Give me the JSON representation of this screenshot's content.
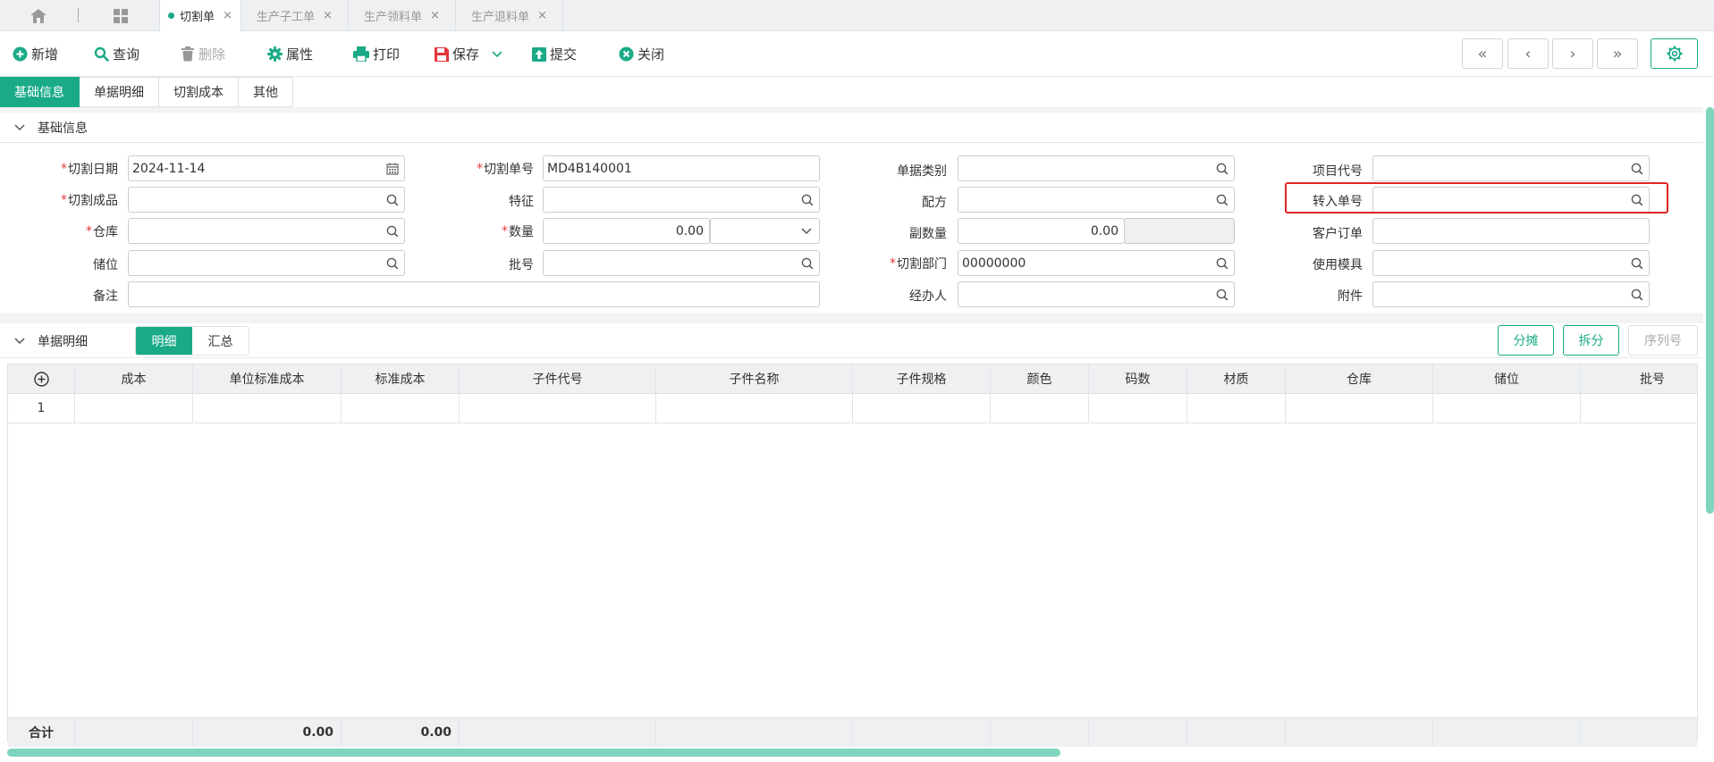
{
  "tabs": [
    {
      "label": "切割单",
      "active": true
    },
    {
      "label": "生产子工单",
      "active": false
    },
    {
      "label": "生产领料单",
      "active": false
    },
    {
      "label": "生产退料单",
      "active": false
    }
  ],
  "tab_close": "×",
  "toolbar": {
    "new": "新增",
    "query": "查询",
    "delete": "删除",
    "properties": "属性",
    "print": "打印",
    "save": "保存",
    "submit": "提交",
    "close": "关闭"
  },
  "nav": {
    "first": "«",
    "prev": "‹",
    "next": "›",
    "last": "»"
  },
  "section_tabs": [
    "基础信息",
    "单据明细",
    "切割成本",
    "其他"
  ],
  "basic_group_title": "基础信息",
  "form": {
    "cut_date": {
      "label": "切割日期",
      "value": "2024-11-14"
    },
    "cut_no": {
      "label": "切割单号",
      "value": "MD4B140001"
    },
    "doc_type": {
      "label": "单据类别",
      "value": ""
    },
    "project_code": {
      "label": "项目代号",
      "value": ""
    },
    "cut_product": {
      "label": "切割成品",
      "value": ""
    },
    "feature": {
      "label": "特征",
      "value": ""
    },
    "formula": {
      "label": "配方",
      "value": ""
    },
    "transfer_no": {
      "label": "转入单号",
      "value": ""
    },
    "warehouse": {
      "label": "仓库",
      "value": ""
    },
    "quantity": {
      "label": "数量",
      "value": "0.00"
    },
    "sub_quantity": {
      "label": "副数量",
      "value": "0.00"
    },
    "customer_order": {
      "label": "客户订单",
      "value": ""
    },
    "location": {
      "label": "储位",
      "value": ""
    },
    "batch_no": {
      "label": "批号",
      "value": ""
    },
    "cut_dept": {
      "label": "切割部门",
      "value": "00000000"
    },
    "mold": {
      "label": "使用模具",
      "value": ""
    },
    "remark": {
      "label": "备注",
      "value": ""
    },
    "handler": {
      "label": "经办人",
      "value": ""
    },
    "attachment": {
      "label": "附件",
      "value": ""
    }
  },
  "required_mark": "*",
  "detail": {
    "title": "单据明细",
    "view_detail": "明细",
    "view_summary": "汇总",
    "allocate": "分摊",
    "split": "拆分",
    "serial_no": "序列号"
  },
  "grid": {
    "columns": [
      "成本",
      "单位标准成本",
      "标准成本",
      "子件代号",
      "子件名称",
      "子件规格",
      "颜色",
      "码数",
      "材质",
      "仓库",
      "储位",
      "批号"
    ],
    "rows": [
      [
        "1",
        "",
        "",
        "",
        "",
        "",
        "",
        "",
        "",
        "",
        "",
        "",
        ""
      ]
    ],
    "footer_label": "合计",
    "footer_unit_std_cost": "0.00",
    "footer_std_cost": "0.00"
  },
  "colors": {
    "accent": "#1aaa87",
    "required": "#e5363c",
    "highlight": "#e02525"
  },
  "icons": [
    "home-icon",
    "grid-icon",
    "plus-circle-icon",
    "search-icon",
    "trash-icon",
    "gear-icon",
    "printer-icon",
    "save-icon",
    "upload-icon",
    "close-circle-icon",
    "calendar-icon",
    "chevron-down-icon",
    "add-row-icon"
  ]
}
